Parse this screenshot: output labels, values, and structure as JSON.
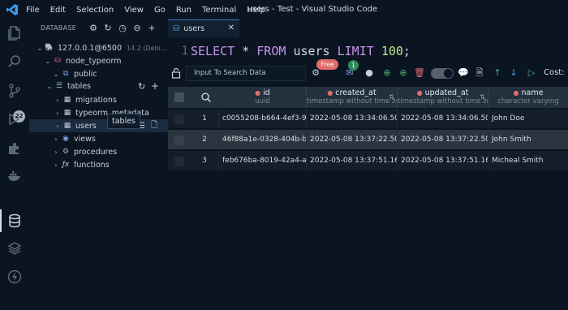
{
  "window": {
    "title": "users - Test - Visual Studio Code",
    "menu": [
      "File",
      "Edit",
      "Selection",
      "View",
      "Go",
      "Run",
      "Terminal",
      "Help"
    ]
  },
  "activity_bar": {
    "items": [
      "explorer-icon",
      "search-icon",
      "source-control-icon",
      "debug-icon",
      "extensions-icon",
      "docker-icon",
      "database-icon",
      "layers-icon",
      "lightning-icon"
    ],
    "source_control_badge": "22"
  },
  "sidebar": {
    "header": "DATABASE",
    "tree": {
      "connection": {
        "label": "127.0.0.1@6500",
        "sub": "14.2 (Debi..."
      },
      "database": "node_typeorm",
      "schema": "public",
      "tables": "tables",
      "migrations": "migrations",
      "typeorm_metadata": "typeorm_metadata",
      "users": "users",
      "views": "views",
      "procedures": "procedures",
      "functions": "functions"
    },
    "tooltip": "tables"
  },
  "editor": {
    "tab_label": "users",
    "line_number": "1",
    "sql": {
      "select": "SELECT",
      "star": "*",
      "from": "FROM",
      "table": "users",
      "limit": "LIMIT",
      "limit_value": "100",
      "semicolon": ";"
    }
  },
  "results_toolbar": {
    "search_placeholder": "Input To Search Data",
    "free_badge": "Free",
    "mail_badge": "1",
    "cost_label": "Cost: 1"
  },
  "table": {
    "columns": [
      {
        "name": "id",
        "type": "uuid"
      },
      {
        "name": "created_at",
        "type": "timestamp without time zone"
      },
      {
        "name": "updated_at",
        "type": "timestamp without time zone"
      },
      {
        "name": "name",
        "type": "character varying"
      }
    ],
    "rows": [
      {
        "n": "1",
        "id": "c0055208-b664-4ef3-94",
        "created_at": "2022-05-08 13:34:06.500",
        "updated_at": "2022-05-08 13:34:06.500",
        "name": "John Doe"
      },
      {
        "n": "2",
        "id": "46f88a1e-0328-404b-b8",
        "created_at": "2022-05-08 13:37:22.502",
        "updated_at": "2022-05-08 13:37:22.502",
        "name": "John Smith"
      },
      {
        "n": "3",
        "id": "feb676ba-8019-42a4-ae",
        "created_at": "2022-05-08 13:37:51.164",
        "updated_at": "2022-05-08 13:37:51.164",
        "name": "Micheal Smith"
      }
    ]
  },
  "colors": {
    "background": "#0b1522",
    "keyword": "#c792ea",
    "number": "#c3e88d",
    "accent": "#3d78c4",
    "required_marker": "#e06c6c"
  }
}
